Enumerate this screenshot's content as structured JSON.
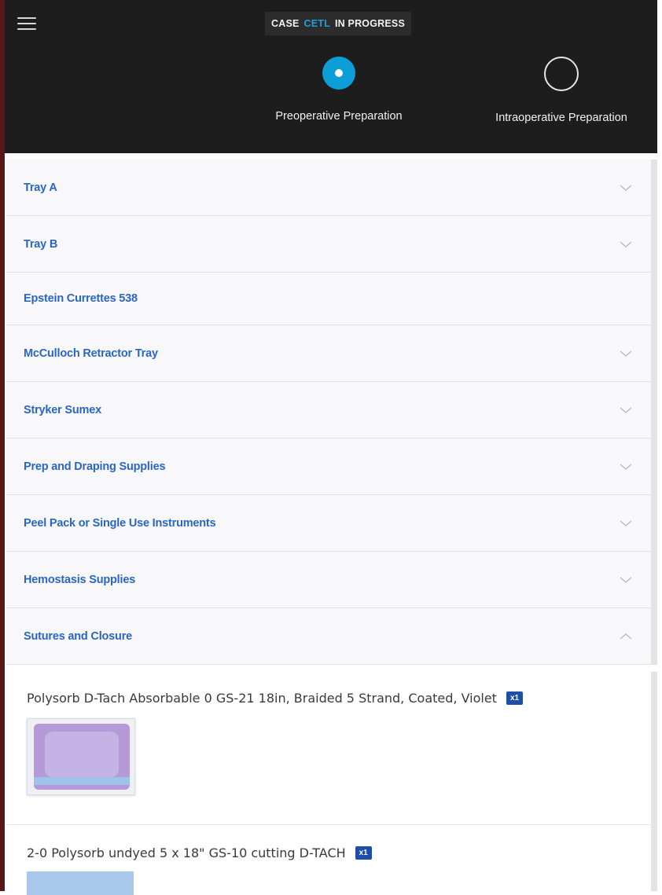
{
  "header": {
    "case_word": "CASE",
    "case_id": "CETL",
    "case_status": "IN PROGRESS"
  },
  "steps": [
    {
      "label": "Preoperative Preparation",
      "state": "active"
    },
    {
      "label": "Intraoperative Preparation",
      "state": "inactive"
    }
  ],
  "sections": [
    {
      "title": "Tray A",
      "chevron": "down"
    },
    {
      "title": "Tray B",
      "chevron": "down"
    },
    {
      "title": "Epstein Currettes 538",
      "chevron": "none"
    },
    {
      "title": "McCulloch Retractor Tray",
      "chevron": "down"
    },
    {
      "title": "Stryker Sumex",
      "chevron": "down"
    },
    {
      "title": "Prep and Draping Supplies",
      "chevron": "down"
    },
    {
      "title": "Peel Pack or Single Use Instruments",
      "chevron": "down"
    },
    {
      "title": "Hemostasis Supplies",
      "chevron": "down"
    },
    {
      "title": "Sutures and Closure",
      "chevron": "up"
    }
  ],
  "items": [
    {
      "name": "Polysorb D-Tach Absorbable 0 GS-21 18in, Braided 5 Strand, Coated, Violet",
      "qty": "x1"
    },
    {
      "name": "2-0 Polysorb undyed 5 x 18\" GS-10 cutting D-TACH",
      "qty": "x1"
    }
  ],
  "colors": {
    "topbar": "#1d1d1d",
    "accent": "#0c9ed6",
    "link": "#2966c4",
    "badge": "#1e4ea8"
  },
  "icons": {
    "menu": "hamburger-icon",
    "chevron_down": "chevron-down-icon",
    "chevron_up": "chevron-up-icon"
  }
}
